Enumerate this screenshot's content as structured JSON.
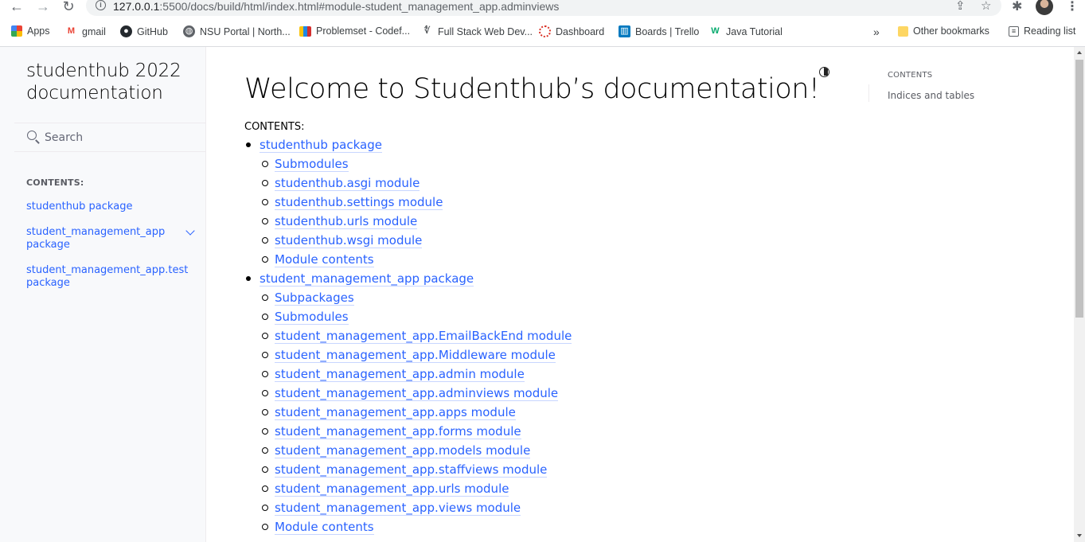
{
  "browser": {
    "url_host": "127.0.0.1",
    "url_path": ":5500/docs/build/html/index.html#module-student_management_app.adminviews",
    "bookmarks": [
      {
        "label": "Apps",
        "icon": "apps-grid-icon"
      },
      {
        "label": "gmail",
        "icon": "gmail-icon"
      },
      {
        "label": "GitHub",
        "icon": "github-icon"
      },
      {
        "label": "NSU Portal | North...",
        "icon": "globe-icon"
      },
      {
        "label": "Problemset - Codef...",
        "icon": "codeforces-icon"
      },
      {
        "label": "Full Stack Web Dev...",
        "icon": "bookmark-favicon-icon"
      },
      {
        "label": "Dashboard",
        "icon": "dashboard-icon"
      },
      {
        "label": "Boards | Trello",
        "icon": "trello-icon"
      },
      {
        "label": "Java Tutorial",
        "icon": "w3schools-icon"
      }
    ],
    "more": "»",
    "other_bookmarks": "Other bookmarks",
    "reading_list": "Reading list"
  },
  "sidebar": {
    "brand": "studenthub 2022 documentation",
    "search_placeholder": "Search",
    "caption": "CONTENTS:",
    "items": [
      {
        "label": "studenthub package"
      },
      {
        "label": "student_management_app package"
      },
      {
        "label": "student_management_app.test package"
      }
    ]
  },
  "main": {
    "title": "Welcome to Studenthub’s documentation!",
    "caption": "CONTENTS:",
    "toc": [
      {
        "level": 1,
        "label": "studenthub package"
      },
      {
        "level": 2,
        "label": "Submodules"
      },
      {
        "level": 2,
        "label": "studenthub.asgi module"
      },
      {
        "level": 2,
        "label": "studenthub.settings module"
      },
      {
        "level": 2,
        "label": "studenthub.urls module"
      },
      {
        "level": 2,
        "label": "studenthub.wsgi module"
      },
      {
        "level": 2,
        "label": "Module contents"
      },
      {
        "level": 1,
        "label": "student_management_app package"
      },
      {
        "level": 2,
        "label": "Subpackages"
      },
      {
        "level": 2,
        "label": "Submodules"
      },
      {
        "level": 2,
        "label": "student_management_app.EmailBackEnd module"
      },
      {
        "level": 2,
        "label": "student_management_app.Middleware module"
      },
      {
        "level": 2,
        "label": "student_management_app.admin module"
      },
      {
        "level": 2,
        "label": "student_management_app.adminviews module"
      },
      {
        "level": 2,
        "label": "student_management_app.apps module"
      },
      {
        "level": 2,
        "label": "student_management_app.forms module"
      },
      {
        "level": 2,
        "label": "student_management_app.models module"
      },
      {
        "level": 2,
        "label": "student_management_app.staffviews module"
      },
      {
        "level": 2,
        "label": "student_management_app.urls module"
      },
      {
        "level": 2,
        "label": "student_management_app.views module"
      },
      {
        "level": 2,
        "label": "Module contents"
      }
    ]
  },
  "right_toc": {
    "title": "CONTENTS",
    "link": "Indices and tables"
  }
}
